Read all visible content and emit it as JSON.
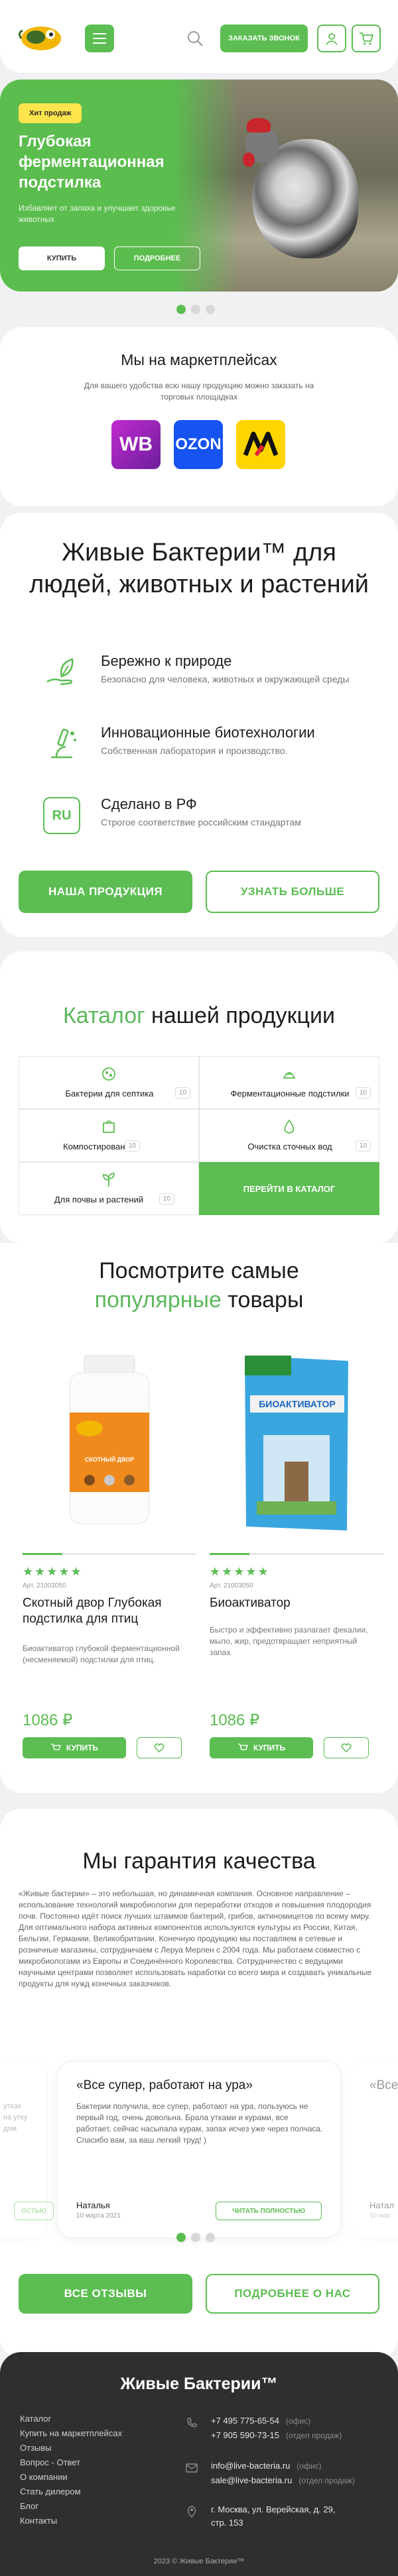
{
  "header": {
    "callback_label": "ЗАКАЗАТЬ ЗВОНОК",
    "icons": [
      "menu-icon",
      "search-icon",
      "user-icon",
      "cart-icon"
    ]
  },
  "hero": {
    "badge": "Хит продаж",
    "title": "Глубокая ферментационная подстилка",
    "subtitle": "Избавляет от запаха и улучшает здоровье животных",
    "buy_label": "КУПИТЬ",
    "more_label": "ПОДРОБНЕЕ"
  },
  "marketplaces": {
    "title": "Мы на маркетплейсах",
    "text": "Для вашего удобства всю нашу продукцию можно заказать на торговых площадках",
    "items": [
      "WB",
      "OZON",
      "M"
    ]
  },
  "live": {
    "title": "Живые Бактерии™ для людей, животных и растений",
    "features": [
      {
        "title": "Бережно к природе",
        "desc": "Безопасно для человека, животных и окружающей среды",
        "icon": "hand-leaf-icon"
      },
      {
        "title": "Инновационные биотехнологии",
        "desc": "Собственная лаборатория и производство.",
        "icon": "microscope-icon"
      },
      {
        "title": "Сделано в РФ",
        "desc": "Строгое соответствие российским стандартам",
        "icon": "ru-badge-icon",
        "badge": "RU"
      }
    ],
    "products_label": "НАША ПРОДУКЦИЯ",
    "more_label": "УЗНАТЬ БОЛЬШЕ"
  },
  "catalog": {
    "title_accent": "Каталог",
    "title_rest": "нашей продукции",
    "items": [
      {
        "label": "Бактерии для септика",
        "count": "10",
        "icon": "septic-icon"
      },
      {
        "label": "Ферментационные подстилки",
        "count": "10",
        "icon": "litter-icon"
      },
      {
        "label": "Компостирование",
        "count": "10",
        "icon": "compost-icon"
      },
      {
        "label": "Очистка сточных вод",
        "count": "10",
        "icon": "water-icon"
      },
      {
        "label": "Для почвы и растений",
        "count": "10",
        "icon": "sprout-icon"
      }
    ],
    "go_label": "ПЕРЕЙТИ В КАТАЛОГ"
  },
  "popular": {
    "title_line1": "Посмотрите самые",
    "title_accent": "популярные",
    "title_rest": "товары",
    "products": [
      {
        "stars": "★★★★★",
        "article": "Арт. 21003050",
        "name": "Скотный двор Глубокая подстилка для птиц",
        "desc": "Биоактиватор глубокой ферментационной (несменяемой) подстилки для птиц.",
        "price": "1086 ₽",
        "buy_label": "КУПИТЬ",
        "image_label": "СКОТНЫЙ ДВОР"
      },
      {
        "stars": "★★★★★",
        "article": "Арт. 21003050",
        "name": "Биоактиватор",
        "desc": "Быстро и эффективно разлагает фекалии, мыло, жир, предотвращает неприятный запах",
        "price": "1086 ₽",
        "buy_label": "КУПИТЬ",
        "image_label": "БИОАКТИВАТОР"
      }
    ]
  },
  "quality": {
    "title": "Мы гарантия качества",
    "text": "«Живые бактерии» – это небольшая, но динамичная компания. Основное направление – использование технологий микробиологии для переработки отходов и повышения плодородия почв. Постоянно идёт поиск лучших штаммов бактерий, грибов, актиномицетов по всему миру. Для оптимального набора активных компонентов используются культуры из России, Китая, Бельгии, Германии, Великобритании. Конечную продукцию мы поставляем в сетевые и розничные магазины, сотрудничаем с Леруа Мерлен с 2004 года. Мы работаем совместно с микробиологами из Европы и Соединённого Королевства. Сотрудничество с ведущими научными центрами позволяет использовать наработки со всего мира и создавать уникальные продукты для нужд конечных заказчиков.",
    "review": {
      "title": "«Все супер, работают на ура»",
      "text": "Бактерии получила, все супер, работают на ура, пользуюсь не первый год, очень довольна. Брала утками и курами, все работает, сейчас насыпала курам, запах исчез уже через полчаса. Спасибо вам, за ваш легкий труд! )",
      "author": "Наталья",
      "date": "10 марта 2021",
      "read_label": "ЧИТАТЬ ПОЛНОСТЬЮ"
    },
    "side_left": {
      "text": "утках\nна утку\nдом",
      "read_label": "ОСТЬЮ"
    },
    "side_right": {
      "title": "«Все с",
      "author": "Натал",
      "date": "10 мар"
    },
    "all_reviews_label": "ВСЕ ОТЗЫВЫ",
    "about_label": "ПОДРОБНЕЕ О НАС"
  },
  "footer": {
    "title": "Живые Бактерии™",
    "nav": [
      "Каталог",
      "Купить на маркетплейсах",
      "Отзывы",
      "Вопрос - Ответ",
      "О компании",
      "Стать дилером",
      "Блог",
      "Контакты"
    ],
    "phone1": "+7 495 775-65-54",
    "phone1_label": "(офис)",
    "phone2": "+7 905 590-73-15",
    "phone2_label": "(отдел продаж)",
    "email1": "info@live-bacteria.ru",
    "email1_label": "(офис)",
    "email2": "sale@live-bacteria.ru",
    "email2_label": "(отдел продаж)",
    "address_line1": "г. Москва, ул. Верейская, д. 29,",
    "address_line2": "стр. 153",
    "copyright": "2023 © Живые Бактерии™"
  },
  "colors": {
    "accent": "#5cbd52",
    "badge": "#ffe54d",
    "footer_bg": "#2e2f31"
  }
}
